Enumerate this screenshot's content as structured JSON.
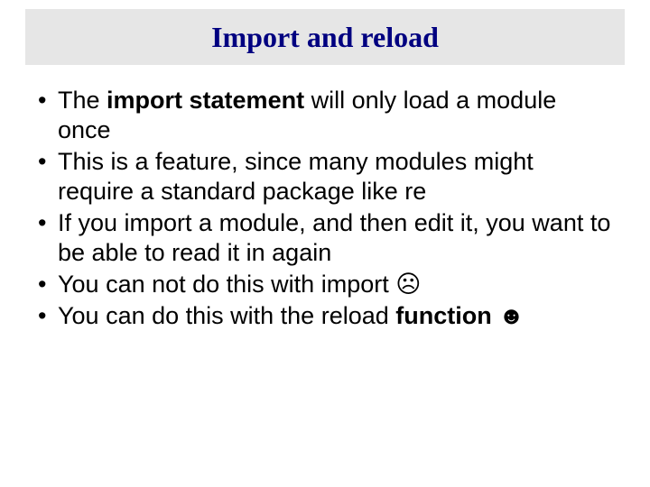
{
  "title": "Import and reload",
  "bullets": {
    "b1": {
      "p1": "The ",
      "bold": "import statement",
      "p2": " will only load a module once"
    },
    "b2": {
      "text": "This is a feature, since many modules might require a standard package like re"
    },
    "b3": {
      "text": "If you import a module, and then edit it, you want to be able to read it in again"
    },
    "b4": {
      "p1": "You can not do this with import ",
      "emoji": "☹"
    },
    "b5": {
      "p1": "You can do this with the reload ",
      "bold": "function",
      "p2": " ",
      "emoji": "☻"
    }
  }
}
